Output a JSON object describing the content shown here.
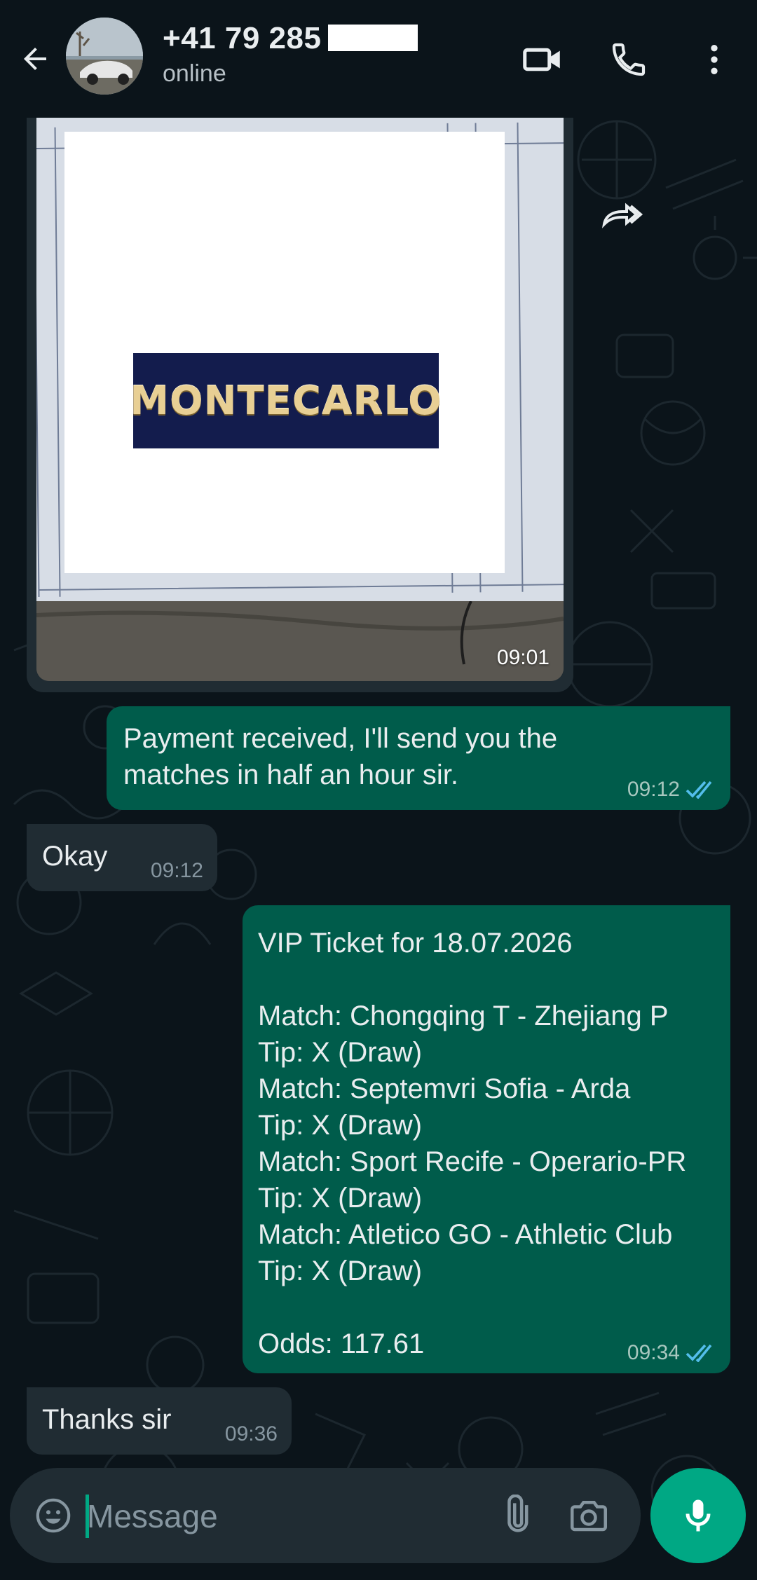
{
  "header": {
    "contact_name": "+41 79 285",
    "status": "online",
    "icons": [
      "back-arrow-icon",
      "video-call-icon",
      "voice-call-icon",
      "more-options-icon"
    ]
  },
  "messages": [
    {
      "type": "image",
      "direction": "in",
      "image_caption_text": "MONTECARLO",
      "time": "09:01"
    },
    {
      "type": "text",
      "direction": "out",
      "text": "Payment received, I'll send you the\nmatches in half an hour sir.",
      "time": "09:12",
      "status": "read"
    },
    {
      "type": "text",
      "direction": "in",
      "text": "Okay",
      "time": "09:12"
    },
    {
      "type": "text",
      "direction": "out",
      "text": "VIP Ticket for 18.07.2026\n\nMatch: Chongqing T - Zhejiang P\nTip: X (Draw)\nMatch: Septemvri Sofia - Arda\nTip: X (Draw)\nMatch: Sport Recife - Operario-PR\nTip: X (Draw)\nMatch: Atletico GO - Athletic Club\nTip: X (Draw)\n\nOdds: 117.61",
      "time": "09:34",
      "status": "read"
    },
    {
      "type": "text",
      "direction": "in",
      "text": "Thanks sir",
      "time": "09:36"
    }
  ],
  "composer": {
    "placeholder": "Message",
    "icons": [
      "emoji-icon",
      "attach-icon",
      "camera-icon",
      "mic-icon"
    ]
  },
  "colors": {
    "background": "#0b141a",
    "incoming_bubble": "#202c33",
    "outgoing_bubble": "#005c4b",
    "accent": "#00a884",
    "read_ticks": "#53bdeb"
  }
}
